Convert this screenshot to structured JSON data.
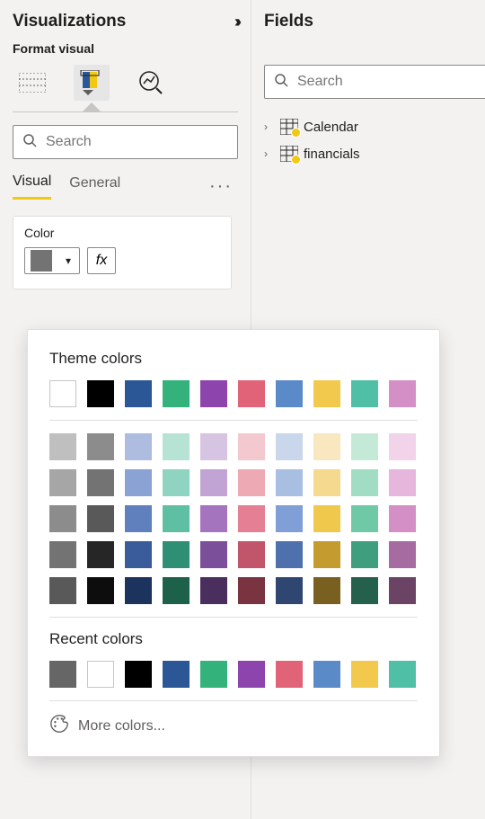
{
  "viz": {
    "title": "Visualizations",
    "subtitle": "Format visual",
    "search_placeholder": "Search",
    "tabs": {
      "visual": "Visual",
      "general": "General"
    },
    "color_card": {
      "label": "Color",
      "fx": "fx"
    }
  },
  "fields": {
    "title": "Fields",
    "search_placeholder": "Search",
    "tables": [
      {
        "name": "Calendar"
      },
      {
        "name": "financials"
      }
    ]
  },
  "picker": {
    "theme_title": "Theme colors",
    "recent_title": "Recent colors",
    "more": "More colors...",
    "theme_top": [
      "#ffffff",
      "#000000",
      "#2b5797",
      "#34b27b",
      "#8e44ad",
      "#e06377",
      "#5b8ac9",
      "#f2c94c",
      "#4fbfa5",
      "#d48fc7"
    ],
    "theme_shades": [
      [
        "#bfbfbf",
        "#8c8c8c",
        "#aebce0",
        "#b7e3d5",
        "#d7c4e2",
        "#f3c9cf",
        "#c9d6ec",
        "#f9e8bf",
        "#c4ead7",
        "#f1d3ea"
      ],
      [
        "#a6a6a6",
        "#737373",
        "#8aa3d4",
        "#8fd3c1",
        "#c1a4d4",
        "#eda9b4",
        "#a9bfe2",
        "#f5d98e",
        "#a1ddc5",
        "#e6b6dd"
      ],
      [
        "#8c8c8c",
        "#595959",
        "#5f80bd",
        "#5ebfa3",
        "#a574bf",
        "#e57f93",
        "#7f9fd6",
        "#f0c94c",
        "#6fc9a6",
        "#d48fc7"
      ],
      [
        "#737373",
        "#262626",
        "#3a5c9b",
        "#2f8f74",
        "#7b4f99",
        "#c1566b",
        "#4e70ad",
        "#c49b2e",
        "#3e9e7e",
        "#a66ba0"
      ],
      [
        "#595959",
        "#0d0d0d",
        "#1c335e",
        "#1d614b",
        "#4a2e5d",
        "#7a3341",
        "#2e4670",
        "#7a6020",
        "#24604b",
        "#6b4365"
      ]
    ],
    "recent": [
      "#666666",
      "#ffffff",
      "#000000",
      "#2b5797",
      "#34b27b",
      "#8e44ad",
      "#e06377",
      "#5b8ac9",
      "#f2c94c",
      "#4fbfa5"
    ]
  }
}
